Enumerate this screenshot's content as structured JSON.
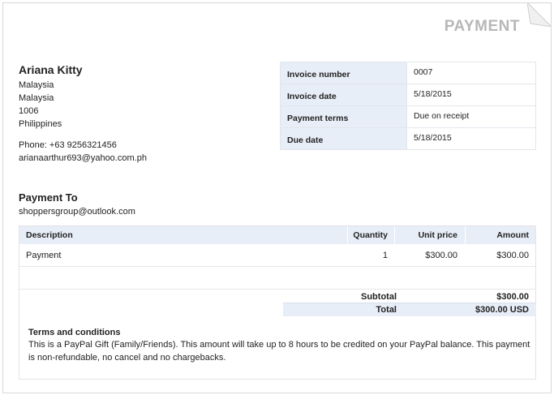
{
  "header": {
    "title": "PAYMENT"
  },
  "seller": {
    "name": "Ariana Kitty",
    "address": [
      "Malaysia",
      "Malaysia",
      "1006",
      "Philippines"
    ],
    "phone": "Phone: +63 9256321456",
    "email": "arianaarthur693@yahoo.com.ph"
  },
  "invoice": {
    "number_label": "Invoice number",
    "number": "0007",
    "date_label": "Invoice date",
    "date": "5/18/2015",
    "terms_label": "Payment terms",
    "terms": "Due on receipt",
    "due_label": "Due date",
    "due": "5/18/2015"
  },
  "pay_to": {
    "heading": "Payment To",
    "email": "shoppersgroup@outlook.com"
  },
  "items": {
    "columns": {
      "description": "Description",
      "quantity": "Quantity",
      "unit_price": "Unit price",
      "amount": "Amount"
    },
    "rows": [
      {
        "description": "Payment",
        "quantity": "1",
        "unit_price": "$300.00",
        "amount": "$300.00"
      }
    ]
  },
  "totals": {
    "subtotal_label": "Subtotal",
    "subtotal": "$300.00",
    "total_label": "Total",
    "total": "$300.00 USD"
  },
  "terms": {
    "heading": "Terms and conditions",
    "text": "This is a PayPal Gift (Family/Friends). This amount will take up to 8 hours to be credited on your PayPal balance. This payment is non-refundable, no cancel and no chargebacks."
  },
  "icons": {
    "page_corner": "folded-corner-icon"
  }
}
